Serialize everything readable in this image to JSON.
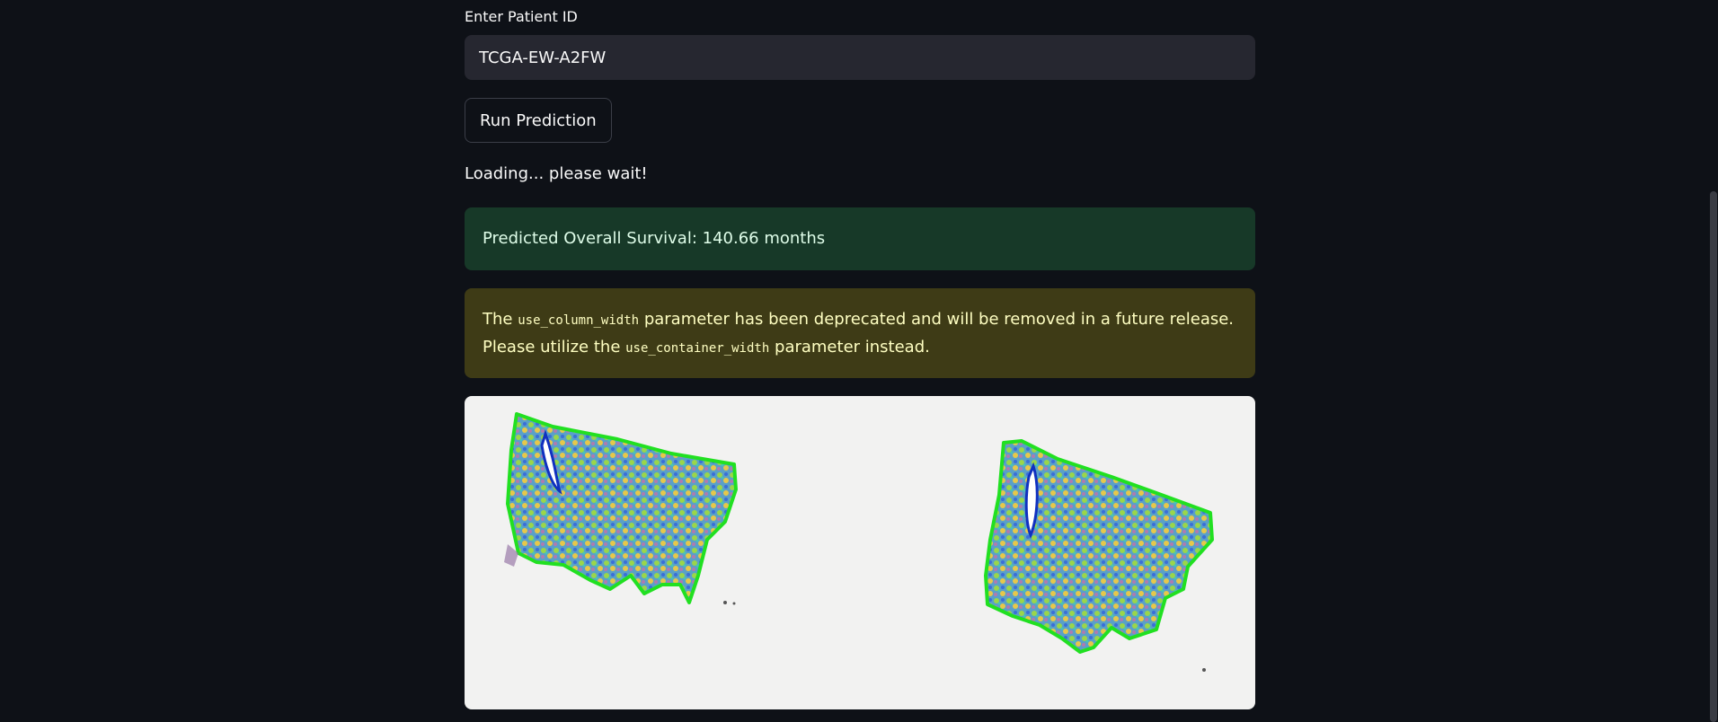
{
  "form": {
    "label": "Enter Patient ID",
    "patient_id_value": "TCGA-EW-A2FW",
    "run_button_label": "Run Prediction"
  },
  "status": {
    "loading_text": "Loading... please wait!"
  },
  "result": {
    "success_message": "Predicted Overall Survival: 140.66 months"
  },
  "warning": {
    "prefix": "The",
    "code_1": "use_column_width",
    "middle": "parameter has been deprecated and will be removed in a future release. Please utilize the",
    "code_2": "use_container_width",
    "suffix": "parameter instead."
  },
  "image": {
    "description_icon": "tissue-slide-heatmap"
  },
  "colors": {
    "background": "#0e1117",
    "input_bg": "#262730",
    "success_bg": "#173928",
    "success_text": "#dffde9",
    "warning_bg": "#3e3b16",
    "warning_text": "#ffffc2",
    "image_bg": "#f2f2f1"
  }
}
